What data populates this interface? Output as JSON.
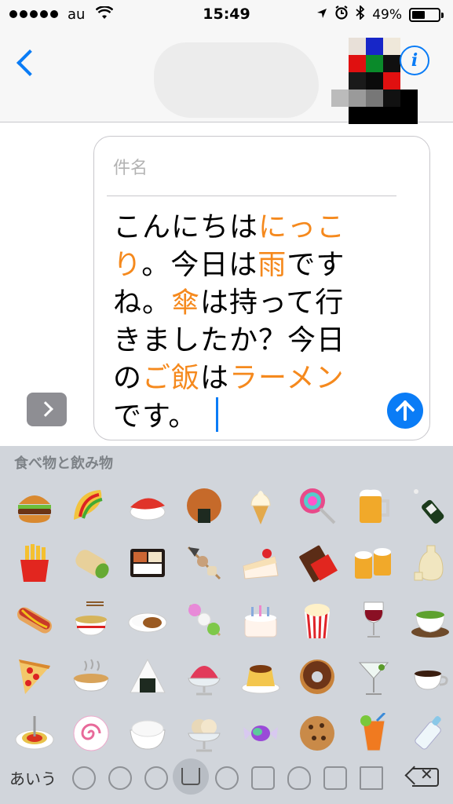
{
  "status_bar": {
    "carrier": "au",
    "time": "15:49",
    "battery": "49%",
    "battery_level": 0.49
  },
  "nav": {
    "back_icon": "chevron-left-icon",
    "info_icon": "info-icon",
    "info_symbol": "i"
  },
  "compose": {
    "subject_placeholder": "件名",
    "message_segments": [
      {
        "text": "こんにちは",
        "hl": false
      },
      {
        "text": "にっこり",
        "hl": true
      },
      {
        "text": "。今日は",
        "hl": false
      },
      {
        "text": "雨",
        "hl": true
      },
      {
        "text": "ですね。",
        "hl": false
      },
      {
        "text": "傘",
        "hl": true
      },
      {
        "text": "は持って行きましたか？今日の",
        "hl": false
      },
      {
        "text": "ご飯",
        "hl": true
      },
      {
        "text": "は",
        "hl": false
      },
      {
        "text": "ラーメン",
        "hl": true
      },
      {
        "text": "です。",
        "hl": false
      }
    ],
    "highlight_color": "#f5891d",
    "accent_color": "#0a7cf6"
  },
  "keyboard": {
    "category_label": "食べ物と飲み物",
    "emojis": [
      "hamburger",
      "taco",
      "sushi",
      "rice-cracker",
      "soft-ice-cream",
      "lollipop",
      "beer-mug",
      "champagne",
      "french-fries",
      "burrito",
      "bento-box",
      "oden",
      "shortcake",
      "chocolate-bar",
      "clinking-beer-mugs",
      "sake",
      "hot-dog",
      "steaming-bowl",
      "curry-rice",
      "dango",
      "birthday-cake",
      "popcorn",
      "wine-glass",
      "green-tea",
      "pizza",
      "stew",
      "rice-ball",
      "shaved-ice",
      "custard",
      "doughnut",
      "cocktail-glass",
      "hot-beverage",
      "spaghetti",
      "fish-cake",
      "cooked-rice",
      "ice-cream",
      "candy",
      "cookie",
      "tropical-drink",
      "baby-bottle"
    ],
    "kana_label": "あいう",
    "toolbar_icons": [
      "clock-icon",
      "smiley-icon",
      "animal-icon",
      "food-icon",
      "soccer-ball-icon",
      "building-icon",
      "lightbulb-icon",
      "symbols-icon",
      "flag-icon",
      "delete-icon"
    ]
  }
}
